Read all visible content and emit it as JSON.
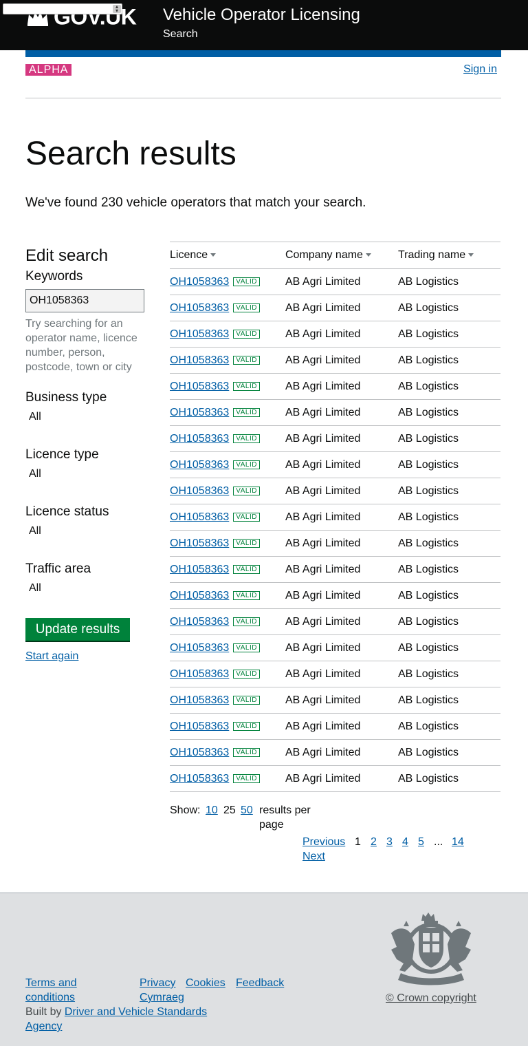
{
  "header": {
    "logo_text": "GOV.UK",
    "service_name": "Vehicle Operator Licensing",
    "nav_search": "Search"
  },
  "phase": {
    "tag": "ALPHA",
    "sign_in": "Sign in"
  },
  "main": {
    "title": "Search results",
    "summary": "We've found 230 vehicle operators that match your search."
  },
  "sidebar": {
    "heading": "Edit search",
    "keywords_label": "Keywords",
    "keywords_value": "OH1058363",
    "keywords_hint": "Try searching for an operator name, licence number, person, postcode, town or city",
    "filters": [
      {
        "label": "Business type",
        "value": "All"
      },
      {
        "label": "Licence type",
        "value": "All"
      },
      {
        "label": "Licence status",
        "value": "All"
      },
      {
        "label": "Traffic area",
        "value": "All"
      }
    ],
    "update_button": "Update results",
    "start_again": "Start again"
  },
  "table": {
    "headers": [
      "Licence",
      "Company name",
      "Trading name"
    ],
    "rows": [
      {
        "licence": "OH1058363",
        "status": "VALID",
        "company": "AB Agri Limited",
        "trading": "AB Logistics"
      },
      {
        "licence": "OH1058363",
        "status": "VALID",
        "company": "AB Agri Limited",
        "trading": "AB Logistics"
      },
      {
        "licence": "OH1058363",
        "status": "VALID",
        "company": "AB Agri Limited",
        "trading": "AB Logistics"
      },
      {
        "licence": "OH1058363",
        "status": "VALID",
        "company": "AB Agri Limited",
        "trading": "AB Logistics"
      },
      {
        "licence": "OH1058363",
        "status": "VALID",
        "company": "AB Agri Limited",
        "trading": "AB Logistics"
      },
      {
        "licence": "OH1058363",
        "status": "VALID",
        "company": "AB Agri Limited",
        "trading": "AB Logistics"
      },
      {
        "licence": "OH1058363",
        "status": "VALID",
        "company": "AB Agri Limited",
        "trading": "AB Logistics"
      },
      {
        "licence": "OH1058363",
        "status": "VALID",
        "company": "AB Agri Limited",
        "trading": "AB Logistics"
      },
      {
        "licence": "OH1058363",
        "status": "VALID",
        "company": "AB Agri Limited",
        "trading": "AB Logistics"
      },
      {
        "licence": "OH1058363",
        "status": "VALID",
        "company": "AB Agri Limited",
        "trading": "AB Logistics"
      },
      {
        "licence": "OH1058363",
        "status": "VALID",
        "company": "AB Agri Limited",
        "trading": "AB Logistics"
      },
      {
        "licence": "OH1058363",
        "status": "VALID",
        "company": "AB Agri Limited",
        "trading": "AB Logistics"
      },
      {
        "licence": "OH1058363",
        "status": "VALID",
        "company": "AB Agri Limited",
        "trading": "AB Logistics"
      },
      {
        "licence": "OH1058363",
        "status": "VALID",
        "company": "AB Agri Limited",
        "trading": "AB Logistics"
      },
      {
        "licence": "OH1058363",
        "status": "VALID",
        "company": "AB Agri Limited",
        "trading": "AB Logistics"
      },
      {
        "licence": "OH1058363",
        "status": "VALID",
        "company": "AB Agri Limited",
        "trading": "AB Logistics"
      },
      {
        "licence": "OH1058363",
        "status": "VALID",
        "company": "AB Agri Limited",
        "trading": "AB Logistics"
      },
      {
        "licence": "OH1058363",
        "status": "VALID",
        "company": "AB Agri Limited",
        "trading": "AB Logistics"
      },
      {
        "licence": "OH1058363",
        "status": "VALID",
        "company": "AB Agri Limited",
        "trading": "AB Logistics"
      },
      {
        "licence": "OH1058363",
        "status": "VALID",
        "company": "AB Agri Limited",
        "trading": "AB Logistics"
      }
    ]
  },
  "results_per_page": {
    "label": "Show:",
    "options": [
      "10",
      "25",
      "50"
    ],
    "selected": "25",
    "suffix": "results per page"
  },
  "pagination": {
    "previous": "Previous",
    "current": "1",
    "pages": [
      "2",
      "3",
      "4",
      "5"
    ],
    "ellipsis": "...",
    "last": "14",
    "next": "Next"
  },
  "footer": {
    "links": {
      "terms": "Terms and conditions",
      "privacy": "Privacy",
      "cookies": "Cookies",
      "feedback": "Feedback",
      "cymraeg": "Cymraeg"
    },
    "built_by_prefix": "Built by ",
    "built_by_link": "Driver and Vehicle Standards Agency",
    "copyright": "© Crown copyright"
  },
  "colors": {
    "header_bg": "#0b0c0c",
    "link": "#005ea5",
    "alpha_tag": "#d53880",
    "button": "#00823b",
    "valid_badge": "#00823b",
    "footer_bg": "#dee0e2"
  },
  "icons": [
    "crown-icon",
    "sort-arrow-icon",
    "royal-coat-of-arms-icon"
  ]
}
